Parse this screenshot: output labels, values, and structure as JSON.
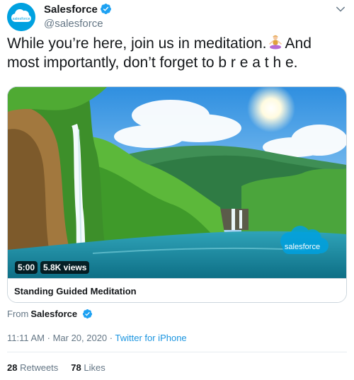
{
  "author": {
    "display_name": "Salesforce",
    "handle": "@salesforce",
    "avatar_text": "salesforce",
    "avatar_icon": "salesforce-cloud-logo",
    "verified_icon": "verified-badge-icon"
  },
  "tweet": {
    "text_part1": "While you’re here, join us in meditation.",
    "emoji": "person-in-lotus-position-emoji",
    "text_part2": "And most importantly, don’t forget to b r e a t h e."
  },
  "media": {
    "duration": "5:00",
    "views": "5.8K views",
    "watermark": "salesforce",
    "title": "Standing Guided Meditation"
  },
  "source": {
    "from_label": "From",
    "from_name": "Salesforce"
  },
  "timestamp": {
    "time": "11:11 AM",
    "sep1": " · ",
    "date": "Mar 20, 2020",
    "sep2": " · ",
    "client": "Twitter for iPhone"
  },
  "stats": {
    "retweets_count": "28",
    "retweets_label": "Retweets",
    "likes_count": "78",
    "likes_label": "Likes"
  },
  "colors": {
    "brand_blue": "#00a1e0",
    "link_blue": "#1b95e0",
    "muted": "#657786",
    "text": "#14171a"
  }
}
